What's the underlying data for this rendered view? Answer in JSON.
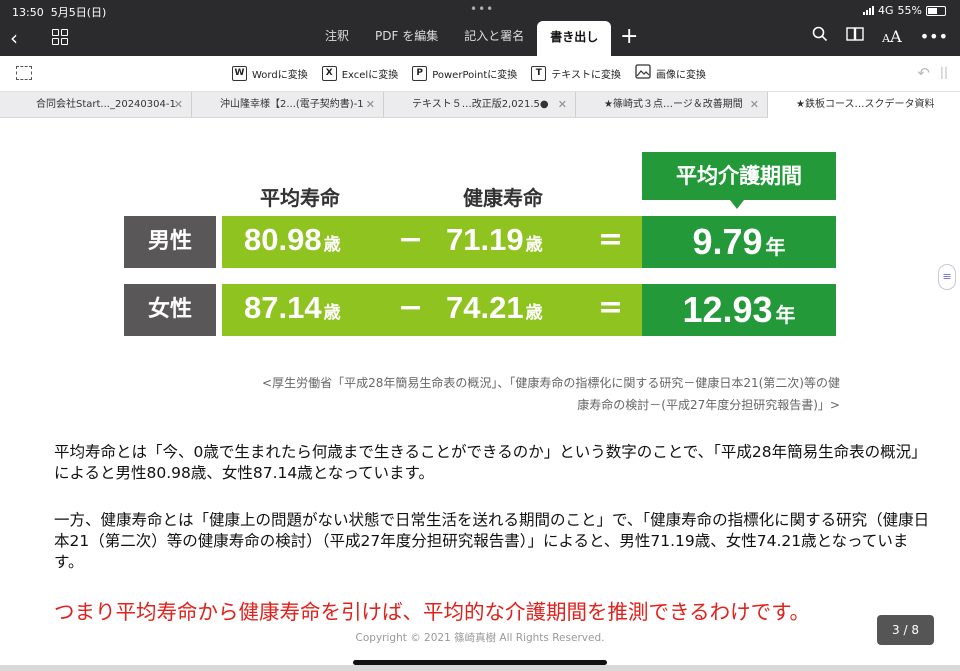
{
  "status": {
    "time": "13:50",
    "date": "5月5日(日)",
    "network": "4G",
    "battery": "55%",
    "battery_level": 0.55
  },
  "toolbar": {
    "tabs": [
      {
        "label": "注釈"
      },
      {
        "label": "PDF を編集"
      },
      {
        "label": "記入と署名"
      },
      {
        "label": "書き出し"
      }
    ],
    "active_tab": "書き出し"
  },
  "export": {
    "items": [
      {
        "icon": "W",
        "label": "Wordに変換"
      },
      {
        "icon": "X",
        "label": "Excelに変換"
      },
      {
        "icon": "P",
        "label": "PowerPointに変換"
      },
      {
        "icon": "T",
        "label": "テキストに変換"
      },
      {
        "icon": "image-icon",
        "label": "画像に変換"
      }
    ]
  },
  "doc_tabs": [
    {
      "label": "合同会社Start..._20240304-1"
    },
    {
      "label": "沖山隆幸様【2...(電子契約書)-1"
    },
    {
      "label": "テキスト５…改正版2,021.5●"
    },
    {
      "label": "★篠崎式３点…ージ＆改善期間"
    },
    {
      "label": "★鉄板コース…スクデータ資料"
    }
  ],
  "infographic": {
    "col_avg": "平均寿命",
    "col_healthy": "健康寿命",
    "col_care": "平均介護期間",
    "unit_age": "歳",
    "unit_year": "年",
    "minus": "−",
    "equals": "=",
    "rows": [
      {
        "label": "男性",
        "avg": "80.98",
        "healthy": "71.19",
        "care": "9.79"
      },
      {
        "label": "女性",
        "avg": "87.14",
        "healthy": "74.21",
        "care": "12.93"
      }
    ],
    "source_line1": "<厚生労働省「平成28年簡易生命表の概況」、「健康寿命の指標化に関する研究－健康日本21(第二次)等の健",
    "source_line2": "康寿命の検討－(平成27年度分担研究報告書)」>"
  },
  "body": {
    "para1": "平均寿命とは「今、0歳で生まれたら何歳まで生きることができるのか」という数字のことで、「平成28年簡易生命表の概況」によると男性80.98歳、女性87.14歳となっています。",
    "para2": "一方、健康寿命とは「健康上の問題がない状態で日常生活を送れる期間のこと」で、「健康寿命の指標化に関する研究（健康日本21（第二次）等の健康寿命の検討）（平成27年度分担研究報告書）」によると、男性71.19歳、女性74.21歳となっています。",
    "conclusion": "つまり平均寿命から健康寿命を引けば、平均的な介護期間を推測できるわけです。",
    "copyright": "Copyright © 2021 篠崎真樹 All Rights Reserved."
  },
  "page_indicator": "3 / 8"
}
